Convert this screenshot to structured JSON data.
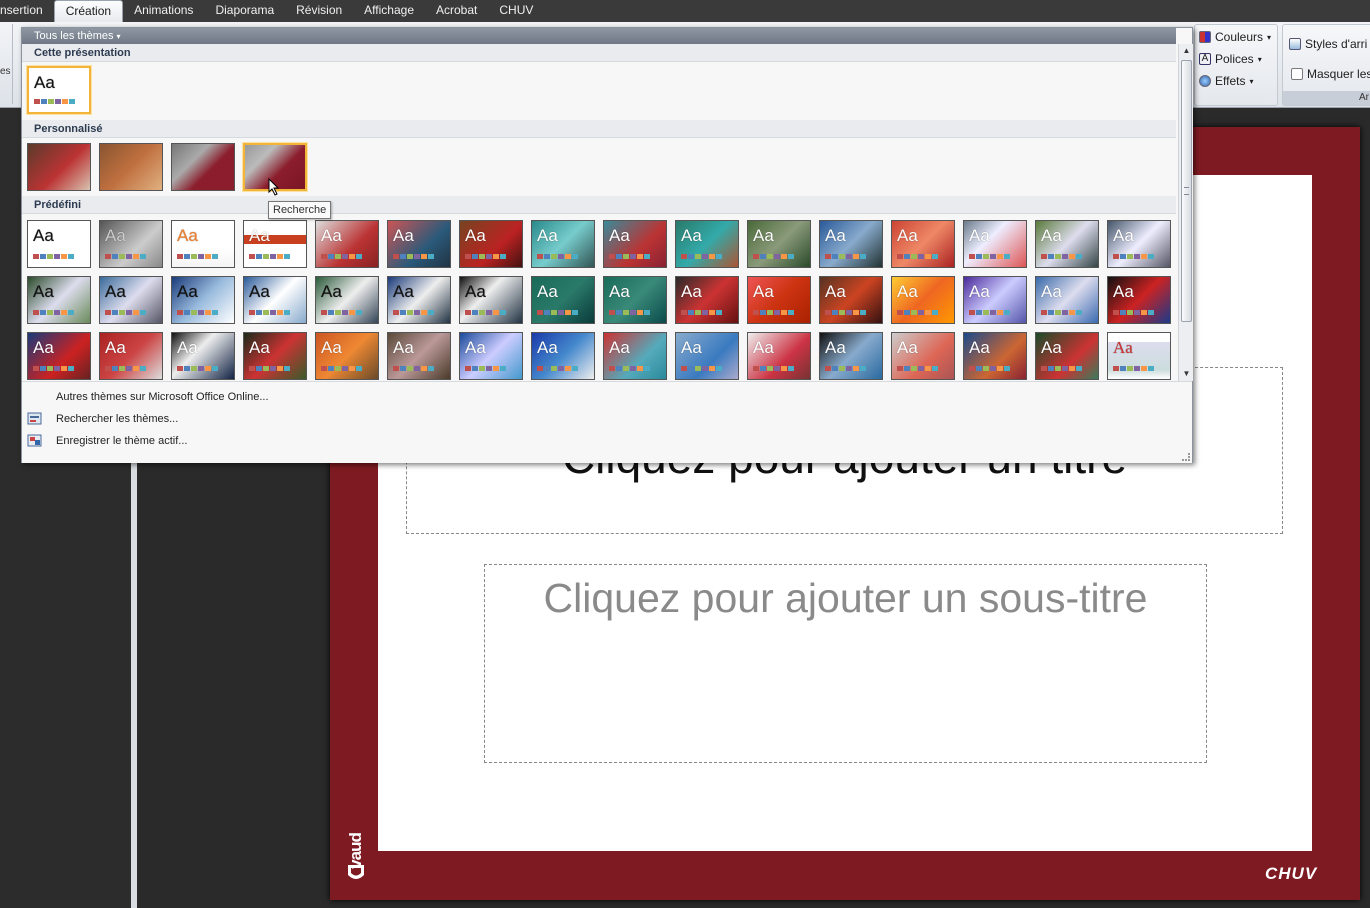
{
  "ribbon": {
    "tabs": [
      "nsertion",
      "Création",
      "Animations",
      "Diaporama",
      "Révision",
      "Affichage",
      "Acrobat",
      "CHUV"
    ],
    "active_tab": "Création",
    "left_fragment": "es",
    "theme_options": {
      "colors": "Couleurs",
      "fonts": "Polices",
      "effects": "Effets"
    },
    "background": {
      "styles": "Styles d'arri",
      "hide": "Masquer les"
    },
    "group_caption_right": "Ar"
  },
  "gallery": {
    "header": "Tous les thèmes",
    "sections": {
      "current": "Cette présentation",
      "custom": "Personnalisé",
      "builtin": "Prédéfini"
    },
    "thumb_text": "Aa",
    "tooltip": "Recherche",
    "footer": {
      "online": "Autres thèmes sur Microsoft Office Online...",
      "browse": "Rechercher les thèmes...",
      "save": "Enregistrer le thème actif..."
    }
  },
  "slide": {
    "title": "Cliquez pour ajouter un titre",
    "subtitle": "Cliquez pour ajouter un sous-titre",
    "logo_left": "vaud",
    "logo_right": "CHUV"
  },
  "colors": {
    "slide_frame": "#7e1a22",
    "selection": "#f2b53a",
    "ribbon_active": "#fdfdfd"
  }
}
